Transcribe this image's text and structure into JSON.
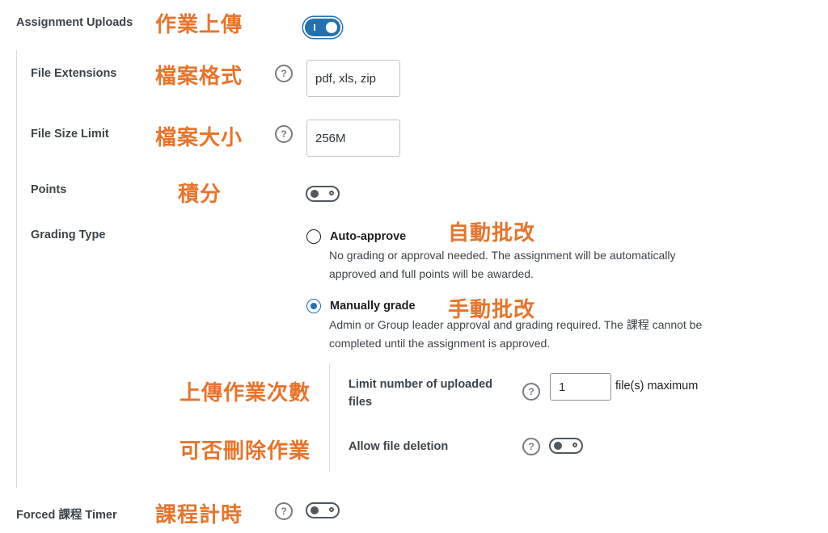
{
  "assignment_uploads": {
    "label": "Assignment Uploads",
    "annotation": "作業上傳"
  },
  "file_extensions": {
    "label": "File Extensions",
    "annotation": "檔案格式",
    "value": "pdf, xls, zip"
  },
  "file_size_limit": {
    "label": "File Size Limit",
    "annotation": "檔案大小",
    "value": "256M"
  },
  "points": {
    "label": "Points",
    "annotation": "積分"
  },
  "grading_type": {
    "label": "Grading Type",
    "auto": {
      "title": "Auto-approve",
      "annotation": "自動批改",
      "line1": "No grading or approval needed. The assignment will be automatically",
      "line2": "approved and full points will be awarded."
    },
    "manual": {
      "title": "Manually grade",
      "annotation": "手動批改",
      "line1": "Admin or Group leader approval and grading required. The 課程 cannot be",
      "line2": "completed until the assignment is approved."
    }
  },
  "limit_uploads": {
    "label_line1": "Limit number of uploaded",
    "label_line2": "files",
    "annotation": "上傳作業次數",
    "value": "1",
    "suffix": "file(s) maximum"
  },
  "allow_deletion": {
    "label": "Allow file deletion",
    "annotation": "可否刪除作業"
  },
  "forced_timer": {
    "label": "Forced 課程 Timer",
    "annotation": "課程計時"
  },
  "help_glyph": "?",
  "colors": {
    "accent": "#2271b1",
    "annotation": "#e8742a"
  }
}
